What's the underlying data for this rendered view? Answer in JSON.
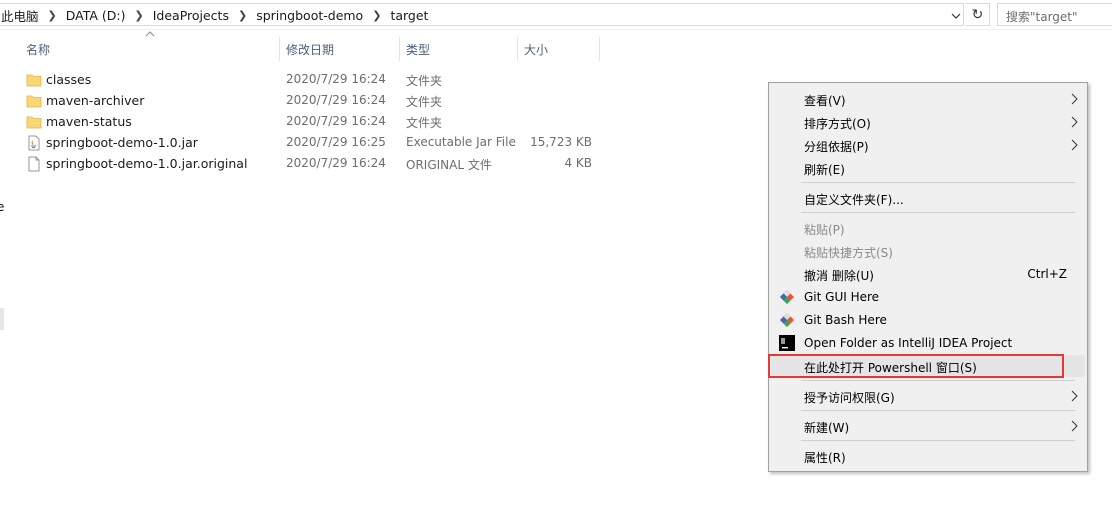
{
  "address": {
    "crumbs": [
      "此电脑",
      "DATA (D:)",
      "IdeaProjects",
      "springboot-demo",
      "target"
    ],
    "search_placeholder": "搜索\"target\""
  },
  "columns": {
    "name": "名称",
    "date": "修改日期",
    "type": "类型",
    "size": "大小"
  },
  "files": [
    {
      "name": "classes",
      "date": "2020/7/29 16:24",
      "type": "文件夹",
      "size": "",
      "icon": "folder-icon"
    },
    {
      "name": "maven-archiver",
      "date": "2020/7/29 16:24",
      "type": "文件夹",
      "size": "",
      "icon": "folder-icon"
    },
    {
      "name": "maven-status",
      "date": "2020/7/29 16:24",
      "type": "文件夹",
      "size": "",
      "icon": "folder-icon"
    },
    {
      "name": "springboot-demo-1.0.jar",
      "date": "2020/7/29 16:25",
      "type": "Executable Jar File",
      "size": "15,723 KB",
      "icon": "java-jar-icon"
    },
    {
      "name": "springboot-demo-1.0.jar.original",
      "date": "2020/7/29 16:24",
      "type": "ORIGINAL 文件",
      "size": "4 KB",
      "icon": "file-icon"
    }
  ],
  "edge_text": "e",
  "context_menu": {
    "view": "查看(V)",
    "sort": "排序方式(O)",
    "group": "分组依据(P)",
    "refresh": "刷新(E)",
    "customize": "自定义文件夹(F)...",
    "paste": "粘贴(P)",
    "paste_shortcut": "粘贴快捷方式(S)",
    "undo": "撤消 删除(U)",
    "undo_shortcut": "Ctrl+Z",
    "git_gui": "Git GUI Here",
    "git_bash": "Git Bash Here",
    "open_idea": "Open Folder as IntelliJ IDEA Project",
    "powershell": "在此处打开 Powershell 窗口(S)",
    "grant_access": "授予访问权限(G)",
    "new": "新建(W)",
    "properties": "属性(R)"
  },
  "colors": {
    "highlight": "#e53935",
    "folder": "#f8d775",
    "header_text": "#4c607a"
  }
}
